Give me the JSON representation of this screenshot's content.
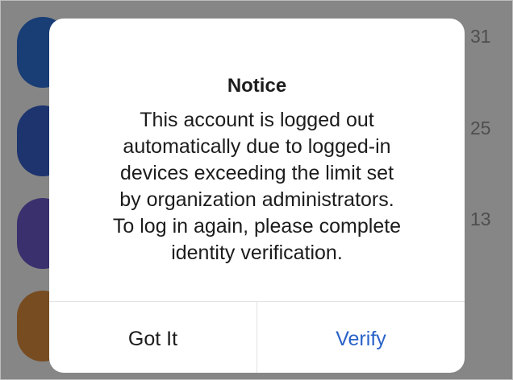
{
  "background": {
    "items": [
      {
        "icon": "shield-app-icon",
        "color": "#2f6fd6",
        "time": "31"
      },
      {
        "icon": "circle-app-icon",
        "color": "#3560c9",
        "time": "25"
      },
      {
        "icon": "purple-app-icon",
        "color": "#6a58c8",
        "time": "13"
      },
      {
        "icon": "orange-app-icon",
        "color": "#d98a3c",
        "time": ""
      }
    ]
  },
  "dialog": {
    "title": "Notice",
    "message_lines": [
      "This account is logged out",
      "automatically due to logged-in",
      "devices exceeding the limit set",
      "by organization administrators.",
      "To log in again, please complete",
      "identity verification."
    ],
    "buttons": {
      "dismiss": "Got It",
      "confirm": "Verify"
    },
    "accent_color": "#2a62c9"
  }
}
